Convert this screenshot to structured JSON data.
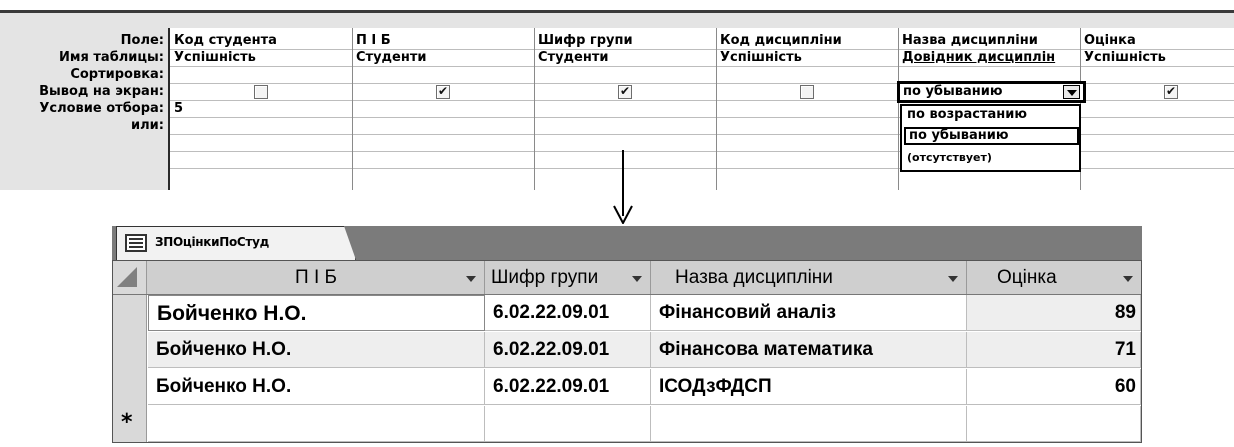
{
  "query_design": {
    "row_labels": [
      "Поле:",
      "Имя таблицы:",
      "Сортировка:",
      "Вывод на экран:",
      "Условие отбора:",
      "или:"
    ],
    "columns": [
      {
        "field": "Код студента",
        "table": "Успішність",
        "sort": "",
        "show": false,
        "criteria": "5"
      },
      {
        "field": "П І Б",
        "table": "Студенти",
        "sort": "",
        "show": true,
        "criteria": ""
      },
      {
        "field": "Шифр групи",
        "table": "Студенти",
        "sort": "",
        "show": true,
        "criteria": ""
      },
      {
        "field": "Код дисципліни",
        "table": "Успішність",
        "sort": "",
        "show": false,
        "criteria": ""
      },
      {
        "field": "Назва дисципліни",
        "table": "Довідник дисциплін",
        "sort": "по убыванию",
        "show": false,
        "criteria": ""
      },
      {
        "field": "Оцінка",
        "table": "Успішність",
        "sort": "",
        "show": true,
        "criteria": ""
      }
    ],
    "sort_dropdown": {
      "value": "по убыванию",
      "options": [
        "по возрастанию",
        "по убыванию",
        "(отсутствует)"
      ],
      "selected_option": "по убыванию"
    }
  },
  "datasheet": {
    "tab_title": "ЗПОцінкиПоСтуд",
    "headers": [
      "П І Б",
      "Шифр групи",
      "Назва дисципліни",
      "Оцінка"
    ],
    "rows": [
      [
        "Бойченко Н.О.",
        "6.02.22.09.01",
        "Фінансовий аналіз",
        "89"
      ],
      [
        "Бойченко Н.О.",
        "6.02.22.09.01",
        "Фінансова математика",
        "71"
      ],
      [
        "Бойченко Н.О.",
        "6.02.22.09.01",
        "ІСОДзФДСП",
        "60"
      ]
    ],
    "new_row_marker": "*"
  },
  "icons": {
    "tab_icon": "query-table-icon",
    "arrow": "down-arrow-icon",
    "dropdown": "chevron-down-icon"
  }
}
